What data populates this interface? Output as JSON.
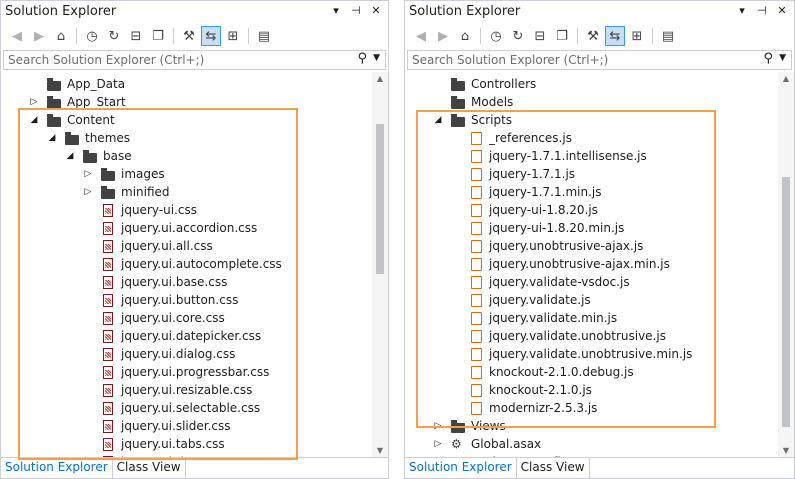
{
  "left": {
    "title": "Solution Explorer",
    "search_placeholder": "Search Solution Explorer (Ctrl+;)",
    "tabs": [
      "Solution Explorer",
      "Class View"
    ],
    "items": [
      {
        "label": "App_Data",
        "type": "folder",
        "indent": 0,
        "arrow": ""
      },
      {
        "label": "App_Start",
        "type": "folder",
        "indent": 0,
        "arrow": "▷"
      },
      {
        "label": "Content",
        "type": "folder",
        "indent": 0,
        "arrow": "◢"
      },
      {
        "label": "themes",
        "type": "folder",
        "indent": 1,
        "arrow": "◢"
      },
      {
        "label": "base",
        "type": "folder",
        "indent": 2,
        "arrow": "◢"
      },
      {
        "label": "images",
        "type": "folder",
        "indent": 3,
        "arrow": "▷"
      },
      {
        "label": "minified",
        "type": "folder",
        "indent": 3,
        "arrow": "▷"
      },
      {
        "label": "jquery-ui.css",
        "type": "css",
        "indent": 3,
        "arrow": ""
      },
      {
        "label": "jquery.ui.accordion.css",
        "type": "css",
        "indent": 3,
        "arrow": ""
      },
      {
        "label": "jquery.ui.all.css",
        "type": "css",
        "indent": 3,
        "arrow": ""
      },
      {
        "label": "jquery.ui.autocomplete.css",
        "type": "css",
        "indent": 3,
        "arrow": ""
      },
      {
        "label": "jquery.ui.base.css",
        "type": "css",
        "indent": 3,
        "arrow": ""
      },
      {
        "label": "jquery.ui.button.css",
        "type": "css",
        "indent": 3,
        "arrow": ""
      },
      {
        "label": "jquery.ui.core.css",
        "type": "css",
        "indent": 3,
        "arrow": ""
      },
      {
        "label": "jquery.ui.datepicker.css",
        "type": "css",
        "indent": 3,
        "arrow": ""
      },
      {
        "label": "jquery.ui.dialog.css",
        "type": "css",
        "indent": 3,
        "arrow": ""
      },
      {
        "label": "jquery.ui.progressbar.css",
        "type": "css",
        "indent": 3,
        "arrow": ""
      },
      {
        "label": "jquery.ui.resizable.css",
        "type": "css",
        "indent": 3,
        "arrow": ""
      },
      {
        "label": "jquery.ui.selectable.css",
        "type": "css",
        "indent": 3,
        "arrow": ""
      },
      {
        "label": "jquery.ui.slider.css",
        "type": "css",
        "indent": 3,
        "arrow": ""
      },
      {
        "label": "jquery.ui.tabs.css",
        "type": "css",
        "indent": 3,
        "arrow": ""
      },
      {
        "label": "jquery.ui.theme.css",
        "type": "css",
        "indent": 3,
        "arrow": ""
      }
    ]
  },
  "right": {
    "title": "Solution Explorer",
    "search_placeholder": "Search Solution Explorer (Ctrl+;)",
    "tabs": [
      "Solution Explorer",
      "Class View"
    ],
    "items": [
      {
        "label": "Controllers",
        "type": "folder",
        "indent": 0,
        "arrow": ""
      },
      {
        "label": "Models",
        "type": "folder",
        "indent": 0,
        "arrow": ""
      },
      {
        "label": "Scripts",
        "type": "folder",
        "indent": 0,
        "arrow": "◢"
      },
      {
        "label": "_references.js",
        "type": "js",
        "indent": 1,
        "arrow": ""
      },
      {
        "label": "jquery-1.7.1.intellisense.js",
        "type": "js",
        "indent": 1,
        "arrow": ""
      },
      {
        "label": "jquery-1.7.1.js",
        "type": "js",
        "indent": 1,
        "arrow": ""
      },
      {
        "label": "jquery-1.7.1.min.js",
        "type": "js",
        "indent": 1,
        "arrow": ""
      },
      {
        "label": "jquery-ui-1.8.20.js",
        "type": "js",
        "indent": 1,
        "arrow": ""
      },
      {
        "label": "jquery-ui-1.8.20.min.js",
        "type": "js",
        "indent": 1,
        "arrow": ""
      },
      {
        "label": "jquery.unobtrusive-ajax.js",
        "type": "js",
        "indent": 1,
        "arrow": ""
      },
      {
        "label": "jquery.unobtrusive-ajax.min.js",
        "type": "js",
        "indent": 1,
        "arrow": ""
      },
      {
        "label": "jquery.validate-vsdoc.js",
        "type": "js",
        "indent": 1,
        "arrow": ""
      },
      {
        "label": "jquery.validate.js",
        "type": "js",
        "indent": 1,
        "arrow": ""
      },
      {
        "label": "jquery.validate.min.js",
        "type": "js",
        "indent": 1,
        "arrow": ""
      },
      {
        "label": "jquery.validate.unobtrusive.js",
        "type": "js",
        "indent": 1,
        "arrow": ""
      },
      {
        "label": "jquery.validate.unobtrusive.min.js",
        "type": "js",
        "indent": 1,
        "arrow": ""
      },
      {
        "label": "knockout-2.1.0.debug.js",
        "type": "js",
        "indent": 1,
        "arrow": ""
      },
      {
        "label": "knockout-2.1.0.js",
        "type": "js",
        "indent": 1,
        "arrow": ""
      },
      {
        "label": "modernizr-2.5.3.js",
        "type": "js",
        "indent": 1,
        "arrow": ""
      },
      {
        "label": "Views",
        "type": "folder",
        "indent": 0,
        "arrow": "▷"
      },
      {
        "label": "Global.asax",
        "type": "asax",
        "indent": 0,
        "arrow": "▷"
      },
      {
        "label": "packages.config",
        "type": "config",
        "indent": 0,
        "arrow": ""
      }
    ]
  }
}
